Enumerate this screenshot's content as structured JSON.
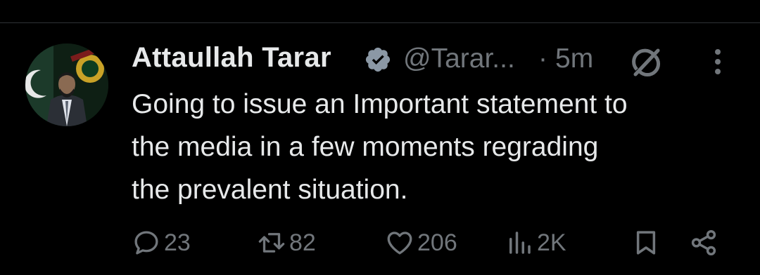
{
  "author": {
    "name": "Attaullah Tarar",
    "handle": "@Tarar...",
    "verified_icon": "verified-badge-icon",
    "verified_color": "#8b98a5"
  },
  "meta": {
    "separator": "·",
    "time": "5m"
  },
  "tweet": {
    "text": "Going to issue an Important statement to\nthe media in a few moments regrading\nthe prevalent situation."
  },
  "actions": {
    "replies": "23",
    "reposts": "82",
    "likes": "206",
    "views": "2K"
  },
  "colors": {
    "background": "#000000",
    "text": "#e7e9ea",
    "muted": "#71767b",
    "divider": "#2f3336"
  }
}
